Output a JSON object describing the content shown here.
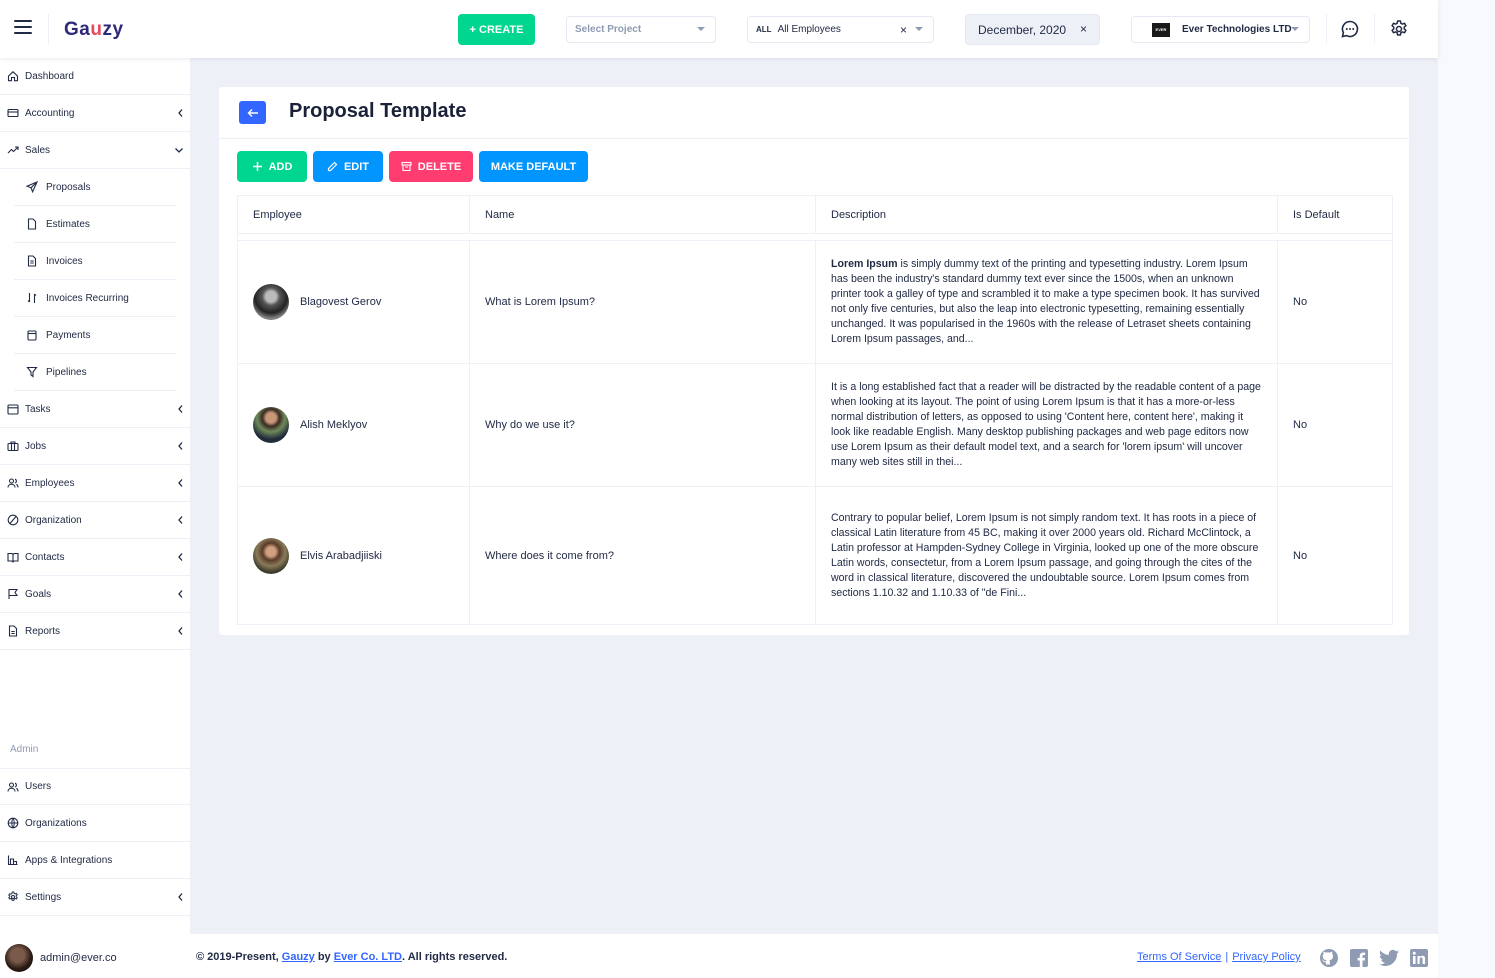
{
  "header": {
    "logo_prefix": "Ga",
    "logo_highlight": "u",
    "logo_suffix": "zy",
    "create_label": "+ CREATE",
    "project_placeholder": "Select Project",
    "employee_scope": "ALL",
    "employee_value": "All Employees",
    "clear_symbol": "×",
    "date_value": "December, 2020",
    "org_logo_text": "EVER",
    "org_value": "Ever Technologies LTD"
  },
  "sidebar": {
    "items": [
      {
        "label": "Dashboard"
      },
      {
        "label": "Accounting"
      },
      {
        "label": "Sales"
      },
      {
        "label": "Tasks"
      },
      {
        "label": "Jobs"
      },
      {
        "label": "Employees"
      },
      {
        "label": "Organization"
      },
      {
        "label": "Contacts"
      },
      {
        "label": "Goals"
      },
      {
        "label": "Reports"
      }
    ],
    "sales_sub": [
      {
        "label": "Proposals"
      },
      {
        "label": "Estimates"
      },
      {
        "label": "Invoices"
      },
      {
        "label": "Invoices Recurring"
      },
      {
        "label": "Payments"
      },
      {
        "label": "Pipelines"
      }
    ],
    "admin_label": "Admin",
    "admin_items": [
      {
        "label": "Users"
      },
      {
        "label": "Organizations"
      },
      {
        "label": "Apps & Integrations"
      },
      {
        "label": "Settings"
      }
    ]
  },
  "page": {
    "title": "Proposal Template",
    "buttons": {
      "add": "ADD",
      "edit": "EDIT",
      "delete": "DELETE",
      "make_default": "MAKE DEFAULT"
    },
    "columns": [
      "Employee",
      "Name",
      "Description",
      "Is Default"
    ],
    "rows": [
      {
        "employee": "Blagovest Gerov",
        "name": "What is Lorem Ipsum?",
        "desc_bold": "Lorem Ipsum",
        "desc_rest": " is simply dummy text of the printing and typesetting industry. Lorem Ipsum has been the industry's standard dummy text ever since the 1500s, when an unknown printer took a galley of type and scrambled it to make a type specimen book. It has survived not only five centuries, but also the leap into electronic typesetting, remaining essentially unchanged. It was popularised in the 1960s with the release of Letraset sheets containing Lorem Ipsum passages, and...",
        "is_default": "No"
      },
      {
        "employee": "Alish Meklyov",
        "name": "Why do we use it?",
        "desc_bold": "",
        "desc_rest": "It is a long established fact that a reader will be distracted by the readable content of a page when looking at its layout. The point of using Lorem Ipsum is that it has a more-or-less normal distribution of letters, as opposed to using 'Content here, content here', making it look like readable English. Many desktop publishing packages and web page editors now use Lorem Ipsum as their default model text, and a search for 'lorem ipsum' will uncover many web sites still in thei...",
        "is_default": "No"
      },
      {
        "employee": "Elvis Arabadjiiski",
        "name": "Where does it come from?",
        "desc_bold": "",
        "desc_rest": "Contrary to popular belief, Lorem Ipsum is not simply random text. It has roots in a piece of classical Latin literature from 45 BC, making it over 2000 years old. Richard McClintock, a Latin professor at Hampden-Sydney College in Virginia, looked up one of the more obscure Latin words, consectetur, from a Lorem Ipsum passage, and going through the cites of the word in classical literature, discovered the undoubtable source. Lorem Ipsum comes from sections 1.10.32 and 1.10.33 of \"de Fini...",
        "is_default": "No"
      }
    ]
  },
  "footer": {
    "user_email": "admin@ever.co",
    "copy_prefix": "© 2019-Present, ",
    "copy_gauzy": "Gauzy",
    "copy_by": " by ",
    "copy_company": "Ever Co. LTD",
    "copy_suffix": ". All rights reserved.",
    "terms": "Terms Of Service",
    "divider": "|",
    "privacy": "Privacy Policy"
  },
  "colors": {
    "success": "#00d68f",
    "primary": "#3366ff",
    "info": "#0095ff",
    "danger": "#ff3d71",
    "background": "#edf1f7"
  }
}
